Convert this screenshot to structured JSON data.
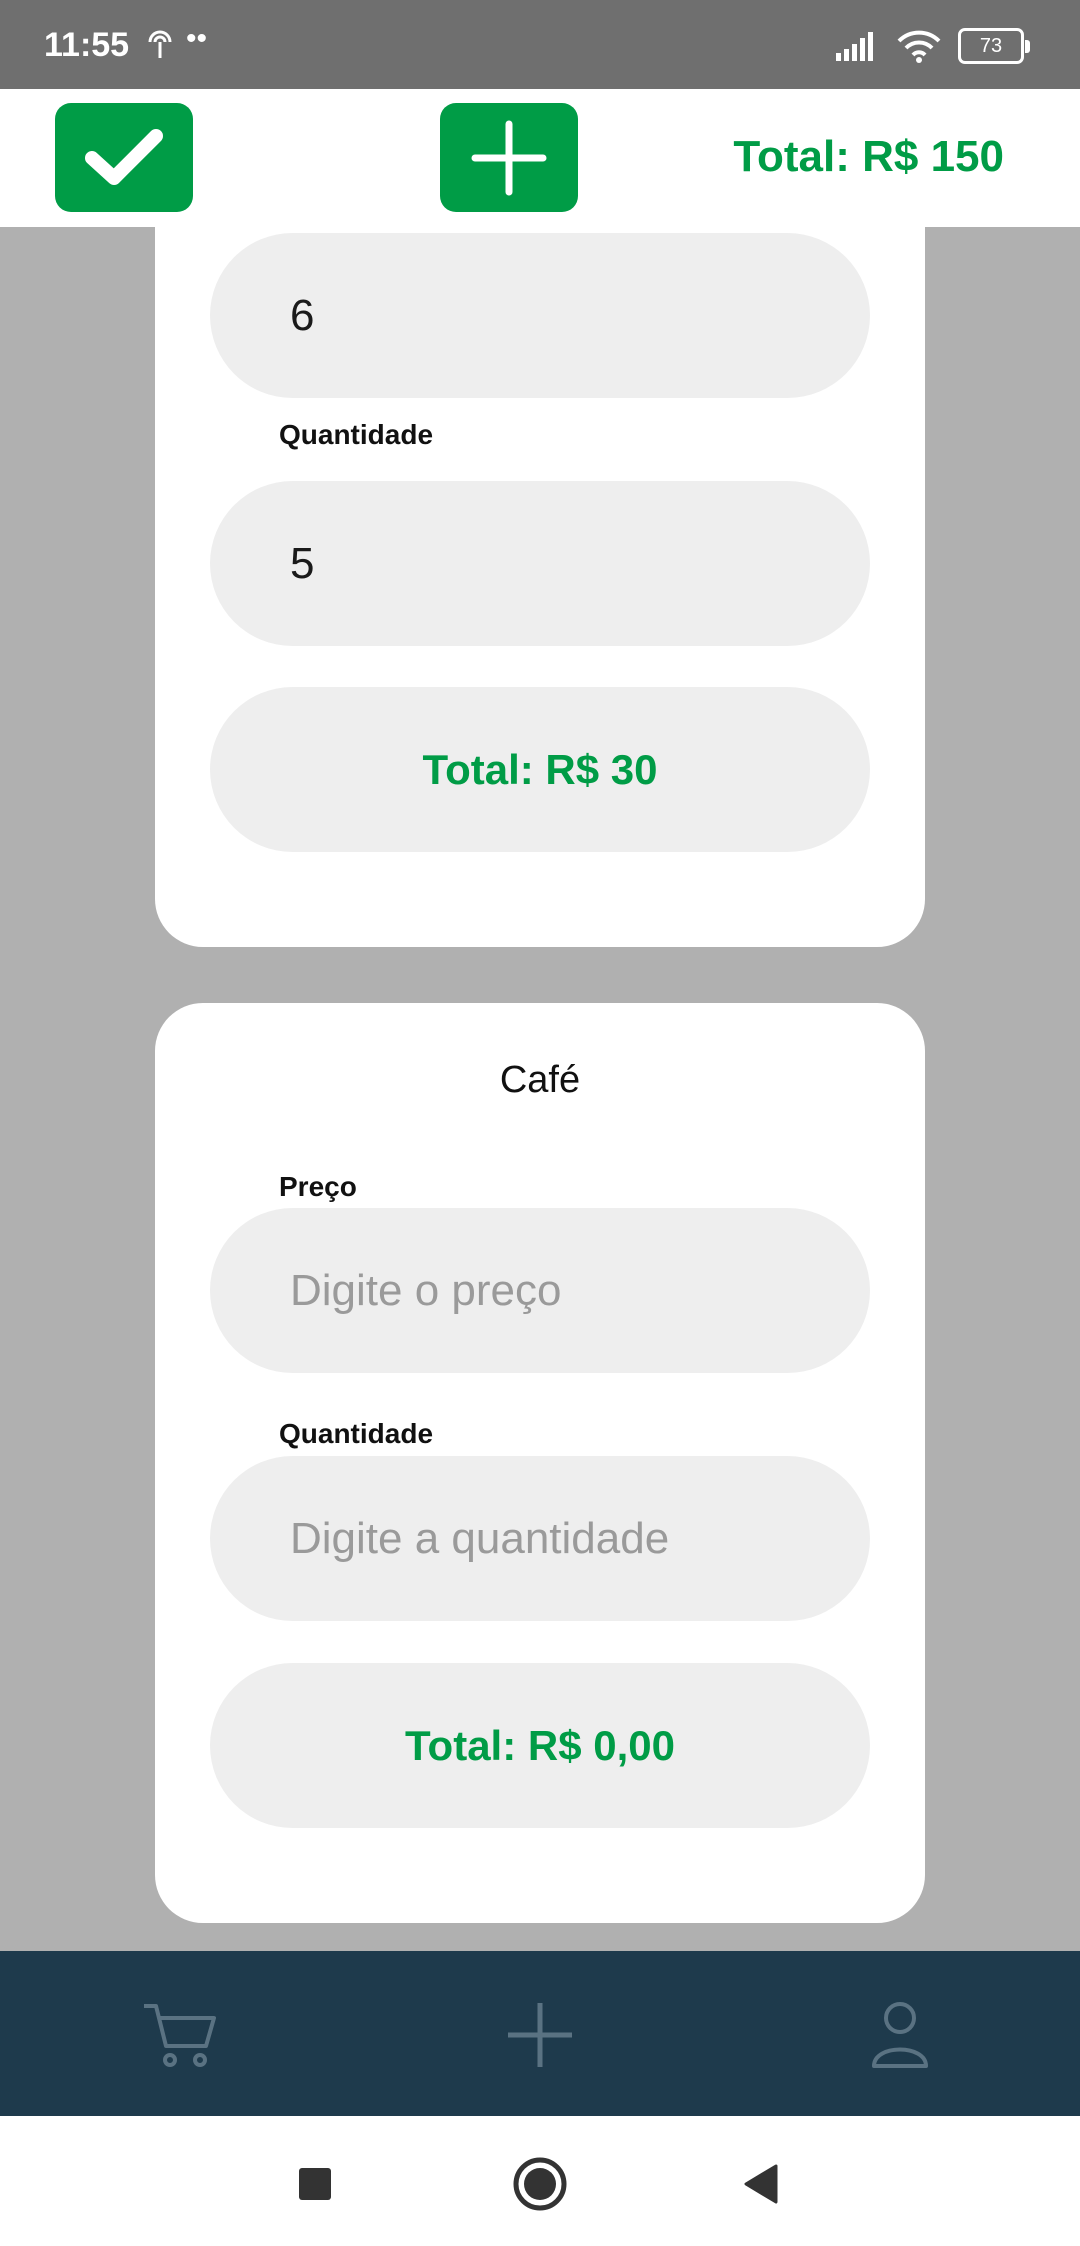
{
  "status_bar": {
    "time": "11:55",
    "dots": "••",
    "battery": "73"
  },
  "toolbar": {
    "total_label": "Total: R$ 150"
  },
  "items": [
    {
      "price_value": "6",
      "quantity_label": "Quantidade",
      "quantity_value": "5",
      "total": "Total: R$ 30"
    },
    {
      "name": "Café",
      "price_label": "Preço",
      "price_placeholder": "Digite o preço",
      "quantity_label": "Quantidade",
      "quantity_placeholder": "Digite a quantidade",
      "total": "Total: R$ 0,00"
    }
  ],
  "bottom_nav": {
    "items": [
      "cart-icon",
      "plus-icon",
      "user-icon"
    ],
    "icon_color": "#5a7282"
  },
  "colors": {
    "accent": "#009c46",
    "nav_bg": "#1e3a4c",
    "page_bg": "#b0b0b0"
  }
}
